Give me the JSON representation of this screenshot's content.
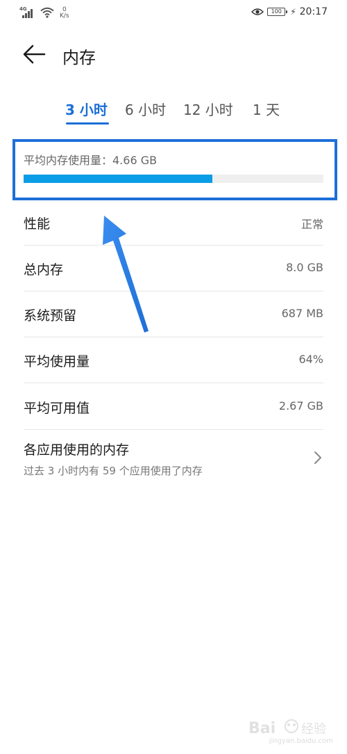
{
  "status_bar": {
    "network_type": "4G",
    "net_speed_value": "0",
    "net_speed_unit": "K/s",
    "battery_level": "100",
    "time": "20:17",
    "icons": [
      "signal-icon",
      "wifi-icon",
      "eye-icon",
      "battery-icon",
      "charging-icon"
    ]
  },
  "header": {
    "title": "内存",
    "back_icon": "back-arrow-icon"
  },
  "tabs": [
    {
      "label": "3 小时",
      "active": true
    },
    {
      "label": "6 小时",
      "active": false
    },
    {
      "label": "12 小时",
      "active": false
    },
    {
      "label": "1 天",
      "active": false
    }
  ],
  "summary": {
    "avg_label": "平均内存使用量：4.66 GB",
    "progress_fraction": 0.63
  },
  "rows": [
    {
      "label": "性能",
      "value": "正常"
    },
    {
      "label": "总内存",
      "value": "8.0 GB"
    },
    {
      "label": "系统预留",
      "value": "687 MB"
    },
    {
      "label": "平均使用量",
      "value": "64%"
    },
    {
      "label": "平均可用值",
      "value": "2.67 GB"
    }
  ],
  "apps_row": {
    "title": "各应用使用的内存",
    "subtitle": "过去 3 小时内有 59 个应用使用了内存",
    "icon": "chevron-right-icon"
  },
  "colors": {
    "accent": "#1a6fd6",
    "progress": "#0a9de6",
    "highlight_border": "#1d6fd8",
    "annotation_arrow": "#2a7de1"
  },
  "watermark": {
    "text": "jingyan.baidu.com"
  }
}
